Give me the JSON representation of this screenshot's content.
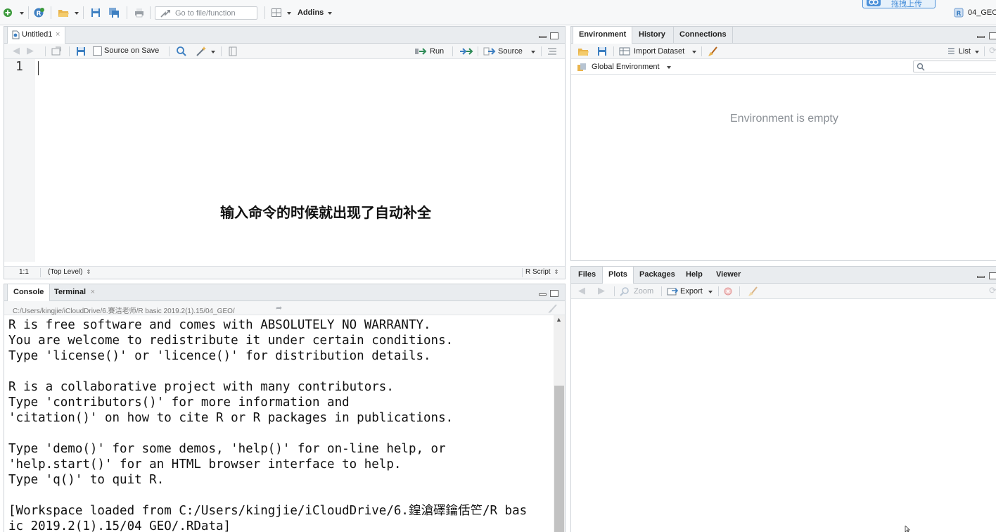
{
  "toolbar": {
    "goto_placeholder": "Go to file/function",
    "addins_label": "Addins",
    "upload_label": "拖拽上传",
    "project_label": "04_GEO"
  },
  "source_pane": {
    "tab_label": "Untitled1",
    "source_on_save_label": "Source on Save",
    "run_label": "Run",
    "source_label": "Source",
    "line_number": "1",
    "overlay_message": "输入命令的时候就出现了自动补全",
    "status_position": "1:1",
    "status_scope": "(Top Level)",
    "status_filetype": "R Script"
  },
  "console_pane": {
    "tabs": [
      {
        "label": "Console"
      },
      {
        "label": "Terminal"
      }
    ],
    "path": "C:/Users/kingjie/iCloudDrive/6.賽洁老师/R basic 2019.2(1).15/04_GEO/",
    "lines": [
      "R is free software and comes with ABSOLUTELY NO WARRANTY.",
      "You are welcome to redistribute it under certain conditions.",
      "Type 'license()' or 'licence()' for distribution details.",
      "",
      "R is a collaborative project with many contributors.",
      "Type 'contributors()' for more information and",
      "'citation()' on how to cite R or R packages in publications.",
      "",
      "Type 'demo()' for some demos, 'help()' for on-line help, or",
      "'help.start()' for an HTML browser interface to help.",
      "Type 'q()' to quit R.",
      "",
      "[Workspace loaded from C:/Users/kingjie/iCloudDrive/6.鍠滄礋鑰佸笀/R bas",
      "ic 2019.2(1).15/04_GEO/.RData]"
    ]
  },
  "env_pane": {
    "tabs": [
      {
        "label": "Environment"
      },
      {
        "label": "History"
      },
      {
        "label": "Connections"
      }
    ],
    "import_label": "Import Dataset",
    "list_label": "List",
    "scope_label": "Global Environment",
    "empty_message": "Environment is empty"
  },
  "files_pane": {
    "tabs": [
      {
        "label": "Files"
      },
      {
        "label": "Plots"
      },
      {
        "label": "Packages"
      },
      {
        "label": "Help"
      },
      {
        "label": "Viewer"
      }
    ],
    "zoom_label": "Zoom",
    "export_label": "Export"
  },
  "colors": {
    "accent": "#4a90d9",
    "run_green": "#2e8b57"
  }
}
